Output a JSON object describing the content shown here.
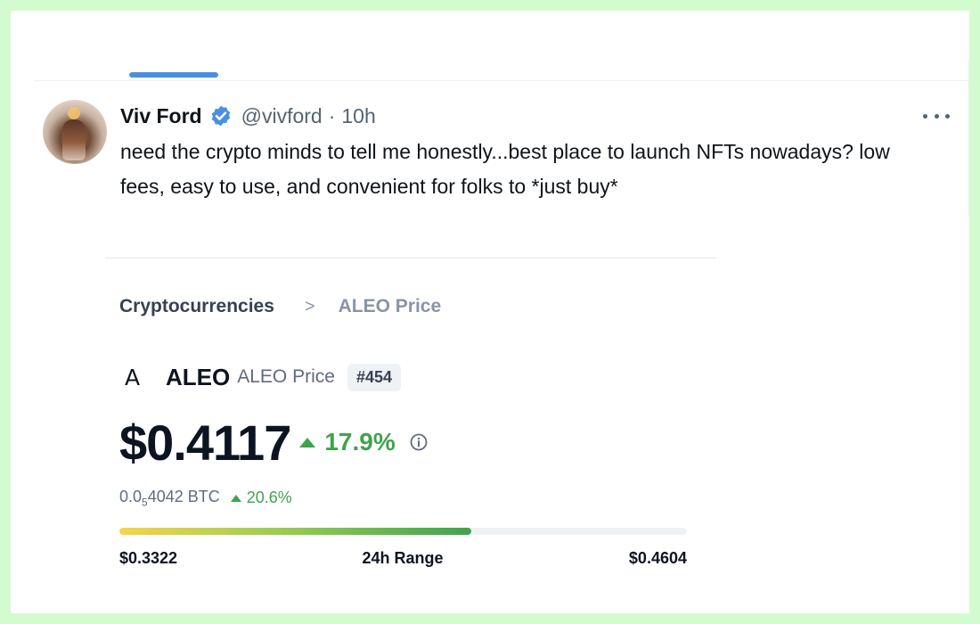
{
  "tweet": {
    "author_name": "Viv Ford",
    "handle": "@vivford",
    "separator": "·",
    "time": "10h",
    "text": "need the crypto minds to tell me honestly...best place to launch NFTs nowadays? low fees, easy to use, and convenient for folks to *just buy*"
  },
  "embed": {
    "breadcrumb": {
      "root": "Cryptocurrencies",
      "separator": ">",
      "current": "ALEO Price"
    },
    "coin": {
      "logo": "A",
      "symbol": "ALEO",
      "subtitle": "ALEO Price",
      "rank": "#454"
    },
    "price": {
      "value": "$0.4117",
      "change": "17.9%",
      "btc_prefix": "0.0",
      "btc_sub": "5",
      "btc_suffix": "4042 BTC",
      "btc_change": "20.6%"
    },
    "range": {
      "low": "$0.3322",
      "label": "24h Range",
      "high": "$0.4604",
      "fill_fraction": 0.62
    }
  },
  "colors": {
    "accent_blue": "#4a90e2",
    "positive_green": "#3fa34d",
    "background_green": "#d3fbd0"
  }
}
